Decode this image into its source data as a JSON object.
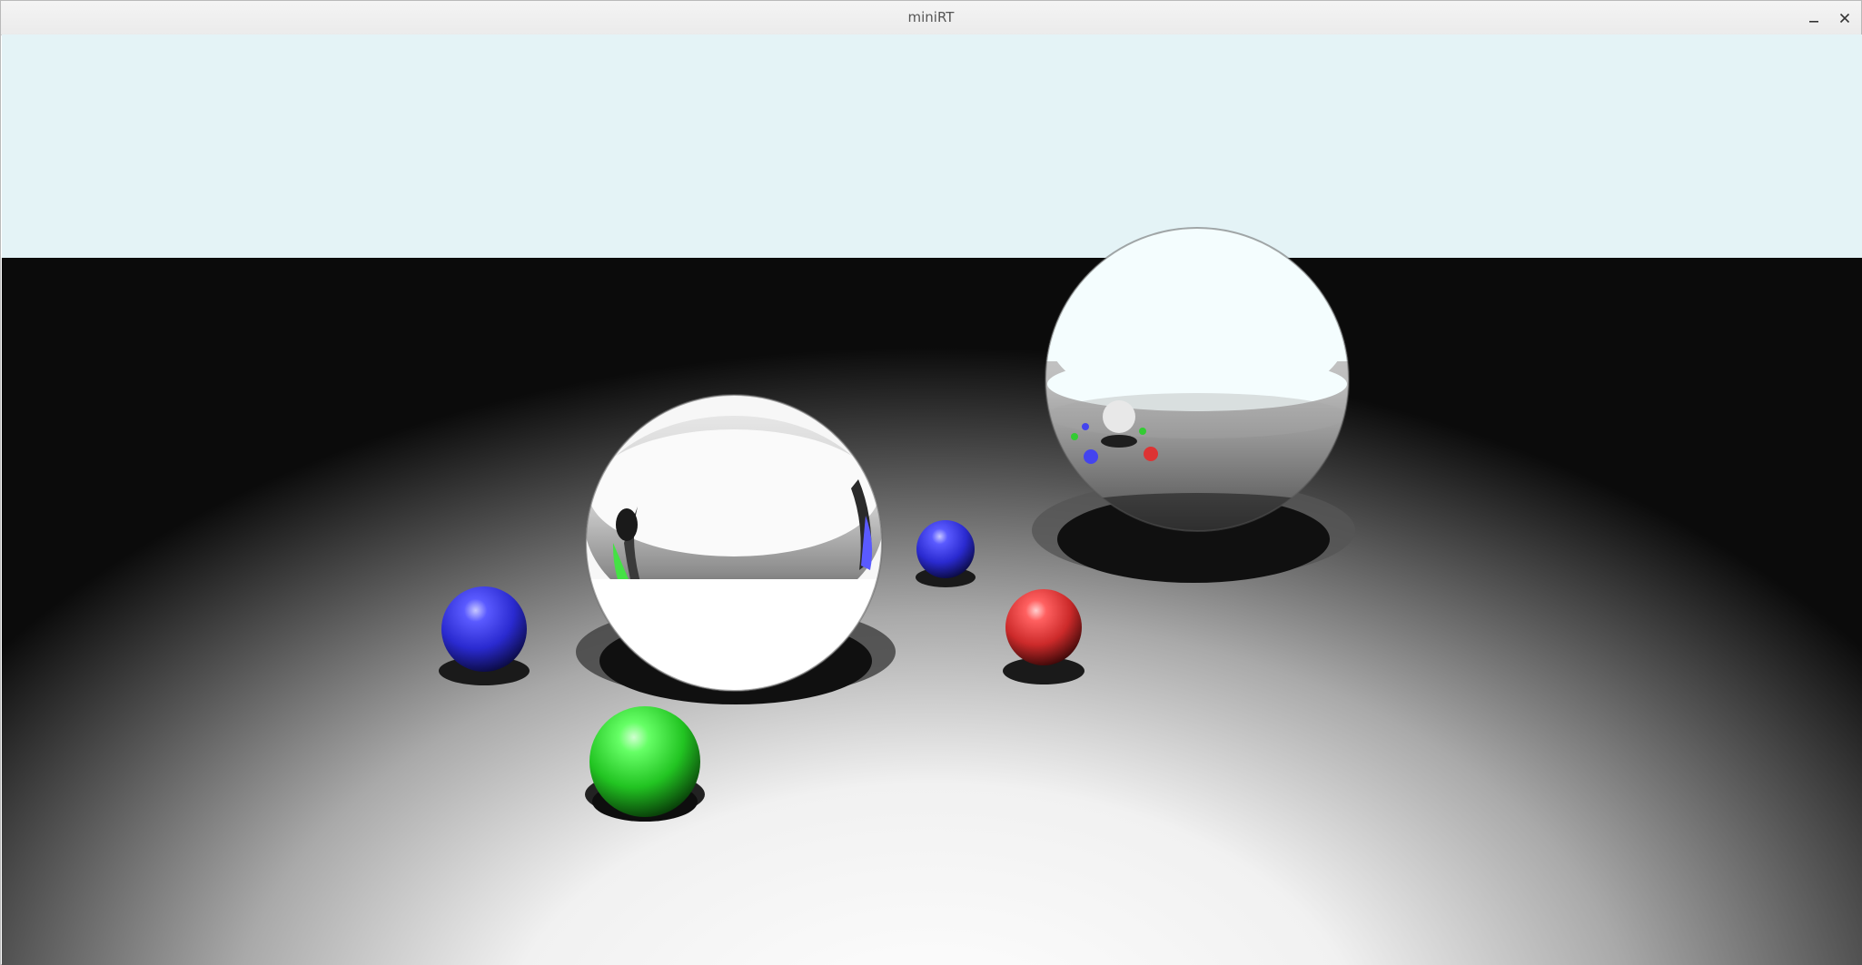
{
  "window": {
    "title": "miniRT",
    "controls": {
      "minimize": "minimize-icon",
      "close": "close-icon"
    }
  },
  "scene": {
    "sky_color": "#e4f3f6",
    "floor_far_color": "#0b0b0b",
    "floor_near_color": "#ffffff",
    "objects": [
      {
        "kind": "mirror-sphere",
        "name": "mirror-sphere-large-left"
      },
      {
        "kind": "mirror-sphere",
        "name": "mirror-sphere-large-right"
      },
      {
        "kind": "sphere",
        "color": "#3333dd",
        "name": "blue-sphere-left"
      },
      {
        "kind": "sphere",
        "color": "#3333dd",
        "name": "blue-sphere-middle"
      },
      {
        "kind": "sphere",
        "color": "#dd3333",
        "name": "red-sphere"
      },
      {
        "kind": "sphere",
        "color": "#33dd33",
        "name": "green-sphere"
      }
    ]
  }
}
